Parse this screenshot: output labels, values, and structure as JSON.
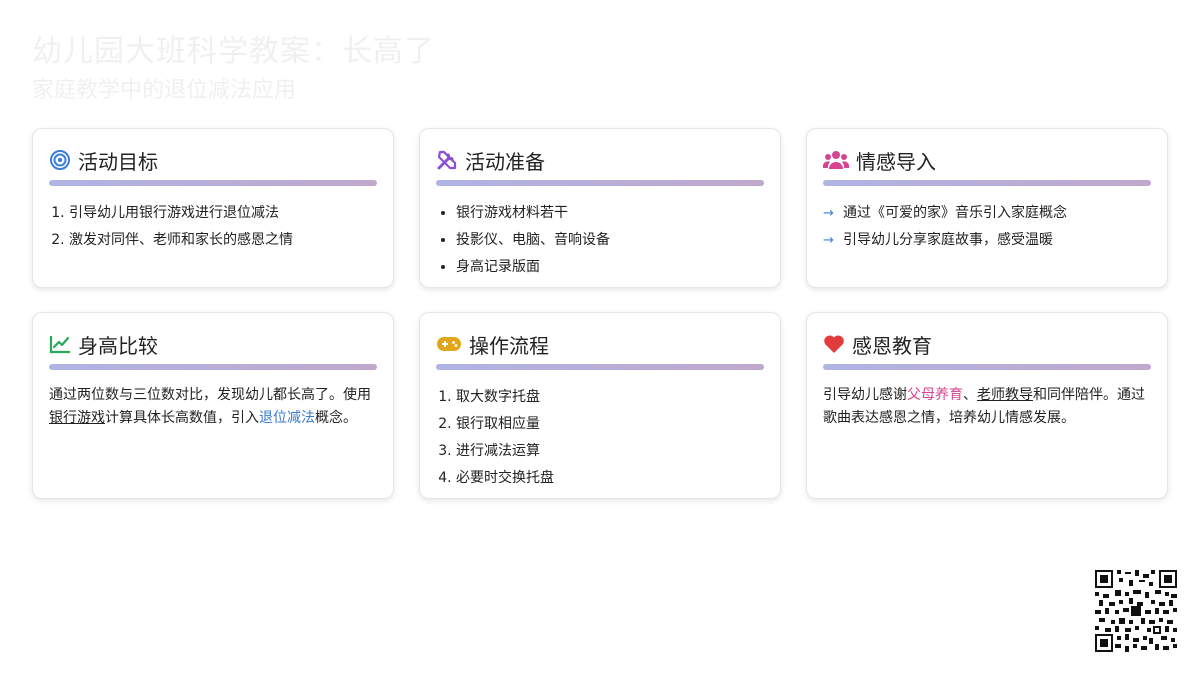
{
  "header": {
    "title": "幼儿园大班科学教案：长高了",
    "subtitle": "家庭教学中的退位减法应用"
  },
  "cards": {
    "goals": {
      "title": "活动目标",
      "icon": "target-icon",
      "items": [
        "引导幼儿用银行游戏进行退位减法",
        "激发对同伴、老师和家长的感恩之情"
      ]
    },
    "prep": {
      "title": "活动准备",
      "icon": "tools-icon",
      "items": [
        "银行游戏材料若干",
        "投影仪、电脑、音响设备",
        "身高记录版面"
      ]
    },
    "intro": {
      "title": "情感导入",
      "icon": "users-icon",
      "items": [
        "通过《可爱的家》音乐引入家庭概念",
        "引导幼儿分享家庭故事，感受温暖"
      ]
    },
    "compare": {
      "title": "身高比较",
      "icon": "chart-line-icon",
      "text_1": "通过两位数与三位数对比，发现幼儿都长高了。使用",
      "link_1": "银行游戏",
      "text_2": "计算具体长高数值，引入",
      "link_2": "退位减法",
      "text_3": "概念。"
    },
    "process": {
      "title": "操作流程",
      "icon": "gamepad-icon",
      "items": [
        "取大数字托盘",
        "银行取相应量",
        "进行减法运算",
        "必要时交换托盘"
      ]
    },
    "gratitude": {
      "title": "感恩教育",
      "icon": "heart-icon",
      "text_1": "引导幼儿感谢",
      "link_1": "父母养育",
      "text_2": "、",
      "link_2": "老师教导",
      "text_3": "和同伴陪伴。通过歌曲表达感恩之情，培养幼儿情感发展。"
    }
  },
  "colors": {
    "target": "#3b7fd8",
    "tools": "#8a4fd6",
    "users": "#d64592",
    "chart": "#27a85a",
    "gamepad": "#e2a717",
    "heart": "#e23b3b",
    "accent_bar": "#b6aedb"
  }
}
